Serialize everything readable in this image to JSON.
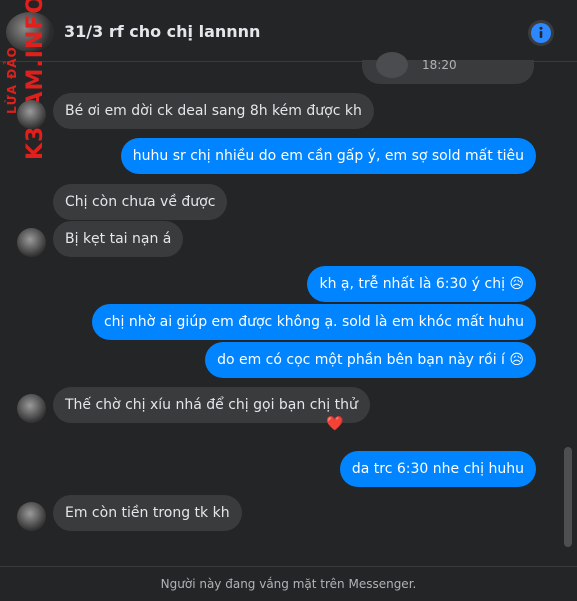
{
  "header": {
    "title": "31/3 rf cho chị lannnn",
    "info_icon": "info-circle-icon",
    "accent": "#2d88ff"
  },
  "watermark": {
    "line_small": "LỪA ĐẢO",
    "line_big": "K3CAM.INFO"
  },
  "previous_message": {
    "time": "18:20"
  },
  "messages": [
    {
      "side": "in",
      "text": "Bé ơi em dời ck deal sang 8h kém được kh"
    },
    {
      "side": "out",
      "text": "huhu sr chị nhiều do em cần gấp ý, em sợ sold mất tiêu"
    },
    {
      "side": "in",
      "text": "Chị còn chưa về được"
    },
    {
      "side": "in",
      "text": "Bị kẹt tai nạn á"
    },
    {
      "side": "out",
      "text": "kh ạ, trễ nhất là 6:30 ý chị 😥"
    },
    {
      "side": "out",
      "text": "chị nhờ ai giúp em được không ạ. sold là em khóc mất huhu"
    },
    {
      "side": "out",
      "text": "do em có cọc một phần bên bạn này rồi í 😥"
    },
    {
      "side": "in",
      "text": "Thế chờ chị xíu nhá để chị gọi bạn chị thử",
      "reaction": "❤️"
    },
    {
      "side": "out",
      "text": "da trc 6:30 nhe chị huhu"
    },
    {
      "side": "in",
      "text": "Em còn tiền trong tk kh"
    }
  ],
  "footer": {
    "status_text": "Người này đang vắng mặt trên Messenger."
  },
  "colors": {
    "background": "#242526",
    "incoming_bubble": "#3a3b3c",
    "outgoing_bubble": "#0084ff",
    "watermark": "#e0201c"
  }
}
